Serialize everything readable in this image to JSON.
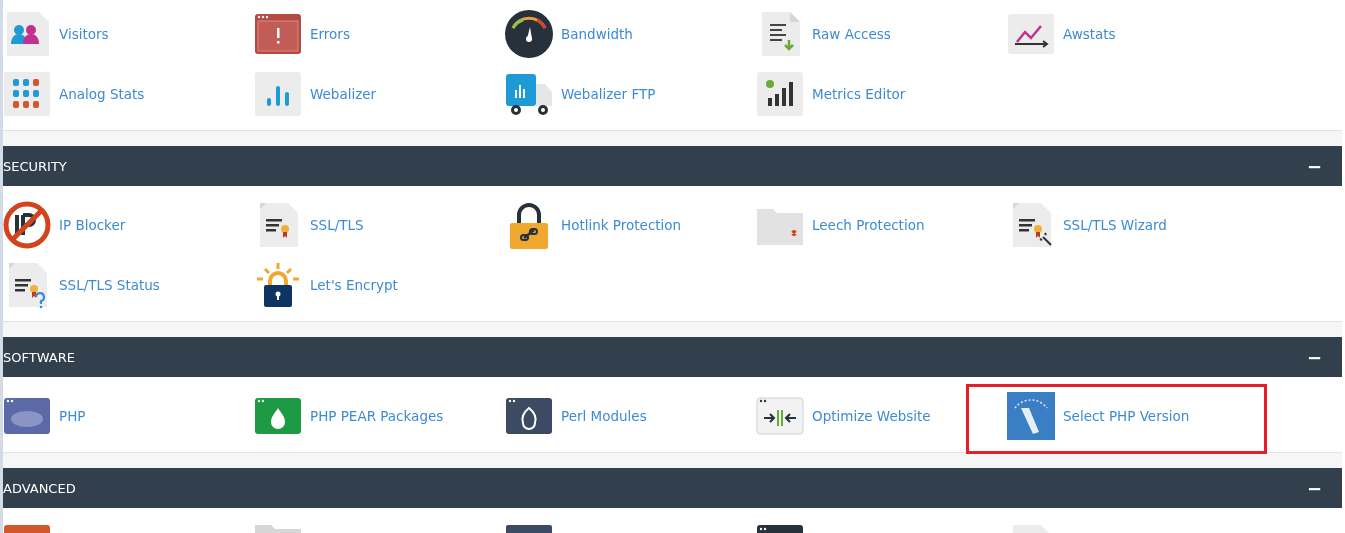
{
  "sections": [
    {
      "items": [
        {
          "kind": "visitors",
          "label": "Visitors"
        },
        {
          "kind": "errors",
          "label": "Errors"
        },
        {
          "kind": "bandwidth",
          "label": "Bandwidth"
        },
        {
          "kind": "raw",
          "label": "Raw Access"
        },
        {
          "kind": "awstats",
          "label": "Awstats"
        },
        {
          "kind": "analog",
          "label": "Analog Stats"
        },
        {
          "kind": "webalizer",
          "label": "Webalizer"
        },
        {
          "kind": "truck",
          "label": "Webalizer FTP"
        },
        {
          "kind": "metrics",
          "label": "Metrics Editor"
        }
      ]
    },
    {
      "title": "SECURITY",
      "toggle": "−",
      "items": [
        {
          "kind": "ipblock",
          "label": "IP Blocker"
        },
        {
          "kind": "cert",
          "label": "SSL/TLS"
        },
        {
          "kind": "lock",
          "label": "Hotlink Protection"
        },
        {
          "kind": "folder",
          "label": "Leech Protection"
        },
        {
          "kind": "wizard",
          "label": "SSL/TLS Wizard"
        },
        {
          "kind": "status",
          "label": "SSL/TLS Status"
        },
        {
          "kind": "encrypt",
          "label": "Let's Encrypt"
        }
      ]
    },
    {
      "title": "SOFTWARE",
      "toggle": "−",
      "items": [
        {
          "kind": "php",
          "label": "PHP",
          "highlighted": false
        },
        {
          "kind": "pear",
          "label": "PHP PEAR Packages",
          "highlighted": false
        },
        {
          "kind": "perl",
          "label": "Perl Modules",
          "highlighted": false
        },
        {
          "kind": "optimize",
          "label": "Optimize Website",
          "highlighted": false
        },
        {
          "kind": "selectphp",
          "label": "Select PHP Version",
          "highlighted": true
        }
      ]
    },
    {
      "title": "ADVANCED",
      "toggle": "−",
      "items": [
        {
          "kind": "adv_orange"
        },
        {
          "kind": "adv_folder"
        },
        {
          "kind": "adv_screen"
        },
        {
          "kind": "adv_window"
        },
        {
          "kind": "adv_doc"
        }
      ]
    }
  ]
}
